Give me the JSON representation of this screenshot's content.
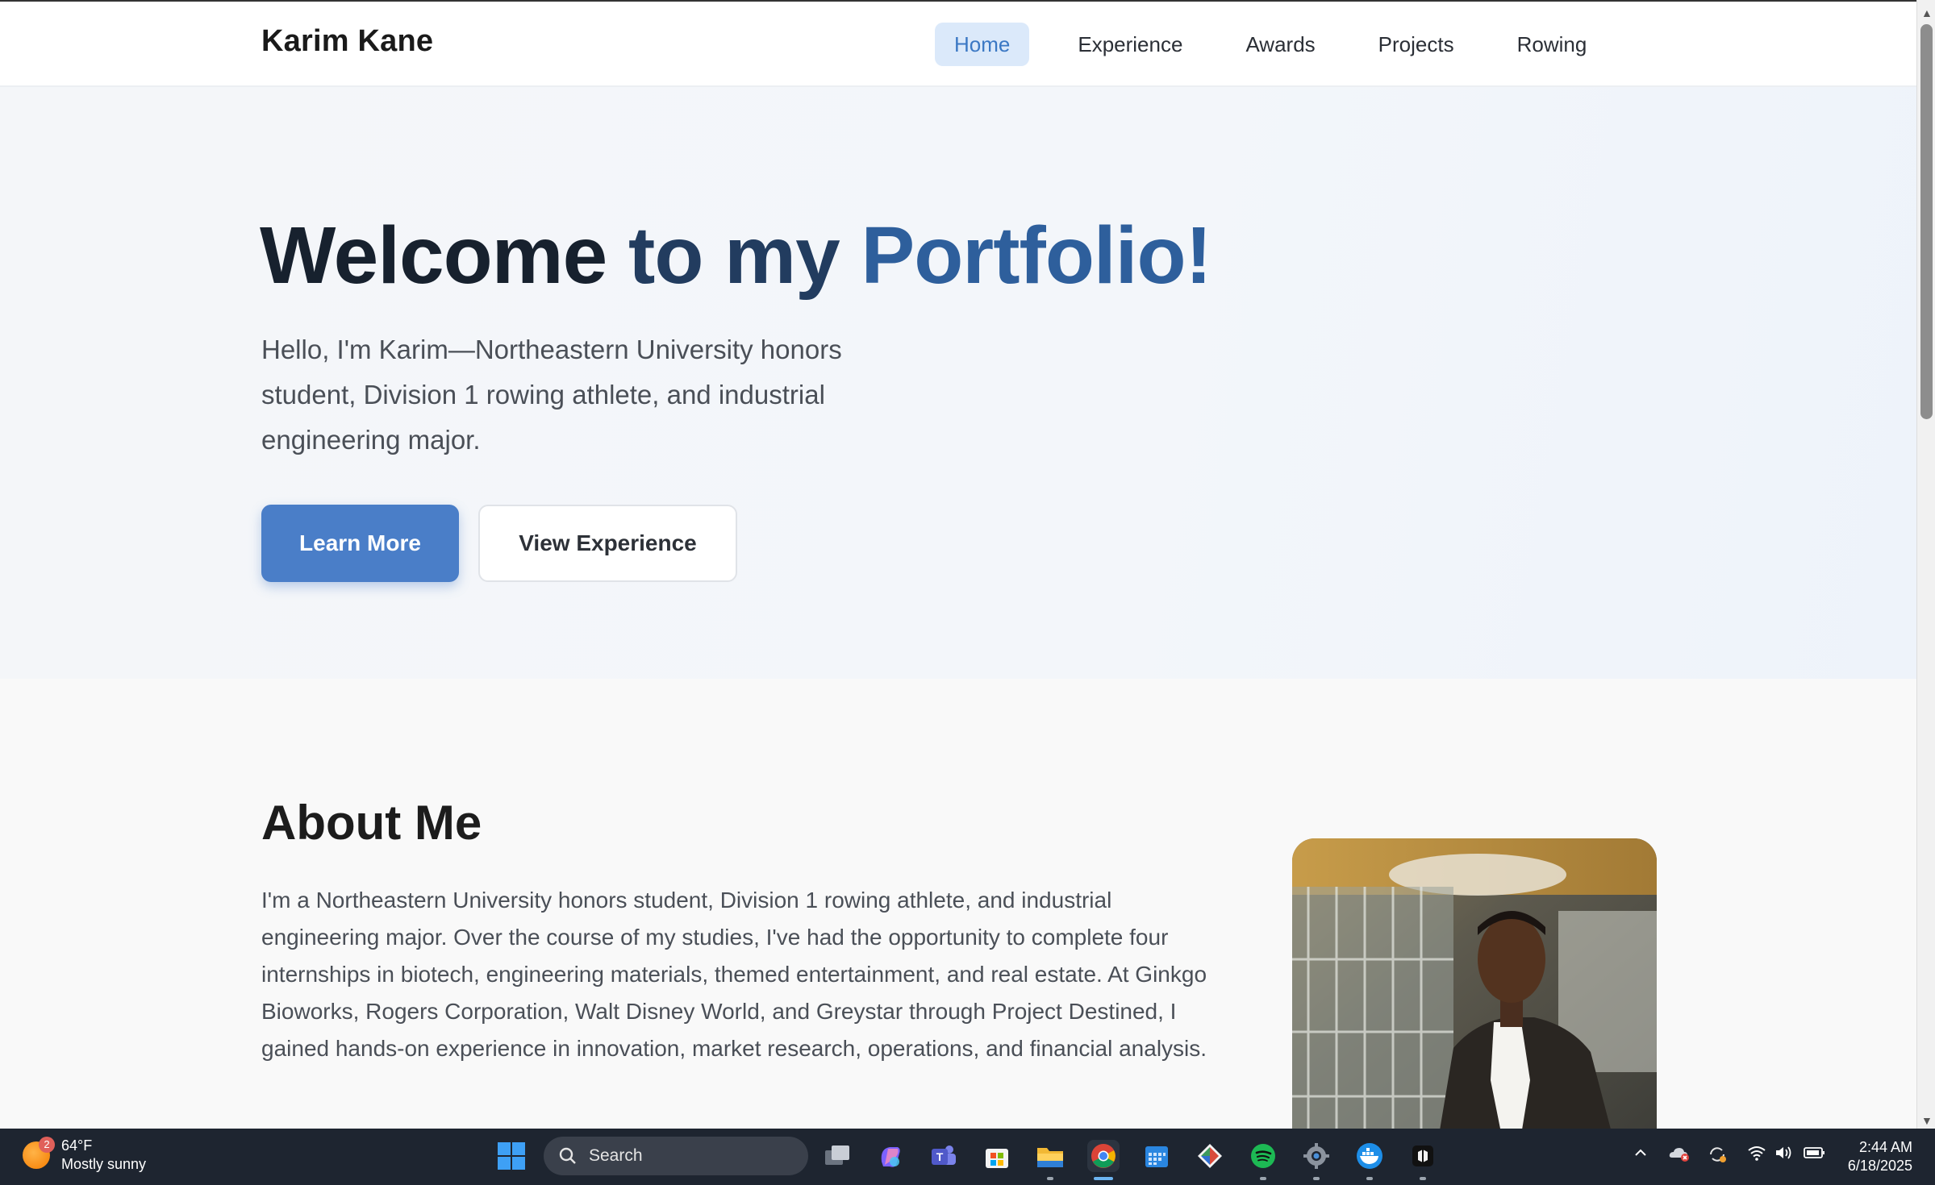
{
  "nav": {
    "brand": "Karim Kane",
    "links": [
      "Home",
      "Experience",
      "Awards",
      "Projects",
      "Rowing"
    ],
    "active": "Home"
  },
  "hero": {
    "title_w1": "Welcome",
    "title_w2": "to my",
    "title_w3": "Portfolio!",
    "subtitle": "Hello, I'm Karim—Northeastern University honors student, Division 1 rowing athlete, and industrial engineering major.",
    "primary_button": "Learn More",
    "secondary_button": "View Experience"
  },
  "about": {
    "title": "About Me",
    "text": "I'm a Northeastern University honors student, Division 1 rowing athlete, and industrial engineering major. Over the course of my studies, I've had the opportunity to complete four internships in biotech, engineering materials, themed entertainment, and real estate. At Ginkgo Bioworks, Rogers Corporation, Walt Disney World, and Greystar through Project Destined, I gained hands-on experience in innovation, market research, operations, and financial analysis."
  },
  "taskbar": {
    "weather_temp": "64°F",
    "weather_desc": "Mostly sunny",
    "weather_badge": "2",
    "search_placeholder": "Search",
    "time": "2:44 AM",
    "date": "6/18/2025"
  },
  "colors": {
    "accent": "#4a7ec8",
    "title_dark": "#17212e",
    "title_blue": "#2e5f9c",
    "nav_active_bg": "#dbe9fa"
  }
}
